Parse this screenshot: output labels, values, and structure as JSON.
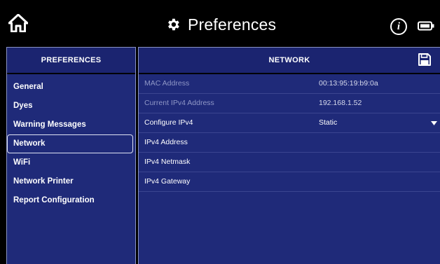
{
  "header": {
    "title": "Preferences"
  },
  "icons": {
    "home": "home-icon",
    "gear": "gear-icon",
    "info": "info-icon",
    "battery": "battery-icon",
    "save": "save-icon",
    "dropdown": "chevron-down-icon"
  },
  "colors": {
    "panel_bg": "#1f2a79",
    "header_bg": "#1b2470",
    "topbar_bg": "#000000",
    "muted_text": "#8f97c6"
  },
  "sidebar": {
    "heading": "PREFERENCES",
    "items": [
      {
        "label": "General"
      },
      {
        "label": "Dyes"
      },
      {
        "label": "Warning Messages"
      },
      {
        "label": "Network",
        "selected": true
      },
      {
        "label": "WiFi"
      },
      {
        "label": "Network Printer"
      },
      {
        "label": "Report Configuration"
      }
    ]
  },
  "main": {
    "heading": "NETWORK",
    "rows": [
      {
        "label": "MAC Address",
        "value": "00:13:95:19:b9:0a",
        "editable": false
      },
      {
        "label": "Current IPv4 Address",
        "value": "192.168.1.52",
        "editable": false
      },
      {
        "label": "Configure IPv4",
        "value": "Static",
        "editable": true,
        "dropdown": true
      },
      {
        "label": "IPv4 Address",
        "value": "",
        "editable": true
      },
      {
        "label": "IPv4 Netmask",
        "value": "",
        "editable": true
      },
      {
        "label": "IPv4 Gateway",
        "value": "",
        "editable": true
      }
    ]
  }
}
